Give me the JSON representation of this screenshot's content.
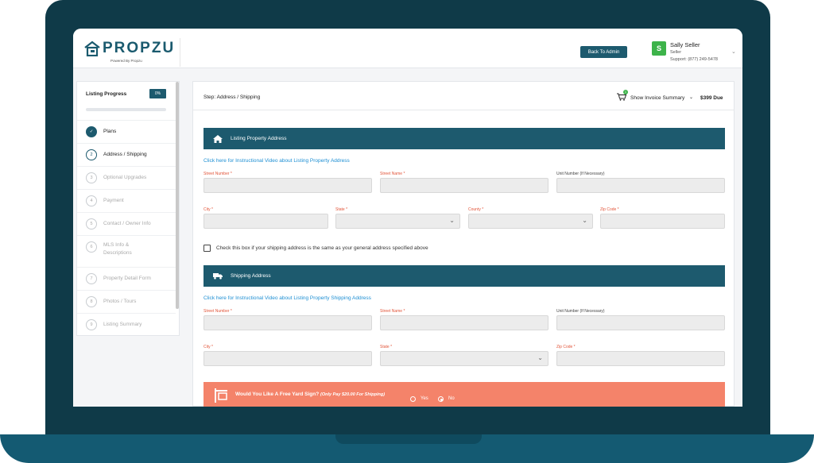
{
  "brand": {
    "name": "PROPZU",
    "tagline": "Powered By Propzu"
  },
  "header": {
    "back_button": "Back To Admin",
    "user": {
      "initial": "S",
      "name": "Sally Seller",
      "role": "Seller",
      "support": "Support: (877) 249-5478"
    }
  },
  "sidebar": {
    "title": "Listing Progress",
    "progress_badge": "0%",
    "progress": 0,
    "items": [
      {
        "num": "✓",
        "label": "Plans"
      },
      {
        "num": "2",
        "label": "Address / Shipping"
      },
      {
        "num": "3",
        "label": "Optional Upgrades"
      },
      {
        "num": "4",
        "label": "Payment"
      },
      {
        "num": "5",
        "label": "Contact / Owner Info"
      },
      {
        "num": "6",
        "label": "MLS Info &"
      },
      {
        "num": "6",
        "label": "Descriptions"
      },
      {
        "num": "7",
        "label": "Property Detail Form"
      },
      {
        "num": "8",
        "label": "Photos / Tours"
      },
      {
        "num": "9",
        "label": "Listing Summary"
      }
    ]
  },
  "main": {
    "step": "Step: Address / Shipping",
    "cart_count": "1",
    "invoice_label": "Show Invoice Summary",
    "due": "$399 Due",
    "listing": {
      "title": "Listing Property Address",
      "link": "Click here for Instructional Video about Listing Property Address",
      "street_number": "Street Number *",
      "street_name": "Street Name *",
      "unit_number": "Unit Number (If Necessary)",
      "city": "City *",
      "state": "State *",
      "county": "County *",
      "zip": "Zip Code *"
    },
    "same_address": "Check this box if your shipping address is the same as your general address specified above",
    "shipping": {
      "title": "Shipping Address",
      "link": "Click here for Instructional Video about Listing Property Shipping Address",
      "street_number": "Street Number *",
      "street_name": "Street Name *",
      "unit_number": "Unit Number (If Necessary)",
      "city": "City *",
      "state": "State *",
      "zip": "Zip Code *"
    },
    "yard_sign": {
      "question": "Would You Like A Free Yard Sign?",
      "note": "(Only Pay $20.00 For Shipping)",
      "yes": "Yes",
      "no": "No"
    }
  },
  "colors": {
    "primary": "#1d5a6e",
    "accent": "#f4836a",
    "link": "#1e8fd3",
    "required": "#e2553a",
    "avatar": "#3db34a"
  }
}
